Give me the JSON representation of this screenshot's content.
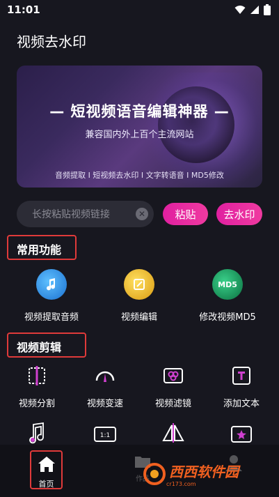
{
  "status_bar": {
    "time": "11:01"
  },
  "app_title": "视频去水印",
  "banner": {
    "headline": "— 短视频语音编辑神器 —",
    "subtitle": "兼容国内外上百个主流网站",
    "features": "音频提取 I 短视频去水印 I 文字转语音 I MD5修改"
  },
  "search": {
    "placeholder": "长按粘贴视频链接"
  },
  "buttons": {
    "paste": "粘贴",
    "remove_watermark": "去水印"
  },
  "sections": {
    "common": "常用功能",
    "video_edit": "视频剪辑"
  },
  "common_functions": [
    {
      "label": "视频提取音频",
      "icon": "music-note-icon",
      "color": "#2a8ee0"
    },
    {
      "label": "视频编辑",
      "icon": "edit-icon",
      "color": "#e8b820"
    },
    {
      "label": "修改视频MD5",
      "icon": "md5-icon",
      "color": "#1a9a5a"
    }
  ],
  "edit_functions": [
    {
      "label": "视频分割",
      "icon": "split-icon"
    },
    {
      "label": "视频变速",
      "icon": "speedometer-icon"
    },
    {
      "label": "视频滤镜",
      "icon": "filter-icon"
    },
    {
      "label": "添加文本",
      "icon": "text-icon"
    }
  ],
  "edit_functions_row2_icons": [
    "music-icon",
    "aspect-ratio-icon",
    "mirror-icon",
    "star-icon"
  ],
  "bottom_nav": {
    "home": "首页",
    "works": "作品"
  },
  "watermark": {
    "text": "西西软件园",
    "sub": "cr173.com"
  },
  "colors": {
    "accent_pink": "#e020a0",
    "highlight_red": "#e03a3a",
    "background": "#17171f"
  }
}
